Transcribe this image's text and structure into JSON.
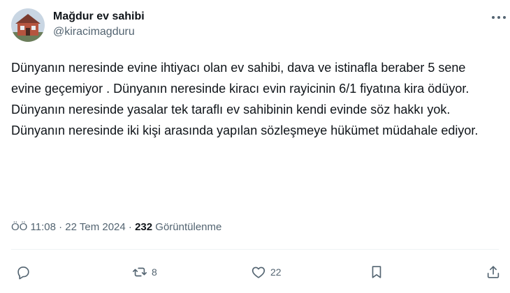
{
  "user": {
    "display_name": "Mağdur ev sahibi",
    "handle": "@kiracimagduru",
    "avatar_icon": "house-photo-avatar"
  },
  "tweet": {
    "lines": [
      "Dünyanın neresinde evine ihtiyacı olan ev sahibi, dava ve istinafla beraber 5 sene evine geçemiyor . Dünyanın neresinde kiracı evin rayicinin 6/1 fiyatına kira ödüyor.",
      "Dünyanın neresinde yasalar tek taraflı ev sahibinin kendi evinde söz hakkı yok.",
      "Dünyanın neresinde iki kişi arasında yapılan sözleşmeye hükümet müdahale ediyor."
    ]
  },
  "meta": {
    "time": "ÖÖ 11:08",
    "separator1": " · ",
    "date": "22 Tem 2024",
    "separator2": " · ",
    "views_count": "232",
    "views_label": " Görüntülenme"
  },
  "actions": {
    "reply_icon": "reply-icon",
    "retweet_icon": "retweet-icon",
    "retweet_count": "8",
    "like_icon": "heart-icon",
    "like_count": "22",
    "bookmark_icon": "bookmark-icon",
    "share_icon": "share-icon"
  },
  "colors": {
    "text_primary": "#0f1419",
    "text_secondary": "#536471",
    "divider": "#eff3f4"
  }
}
